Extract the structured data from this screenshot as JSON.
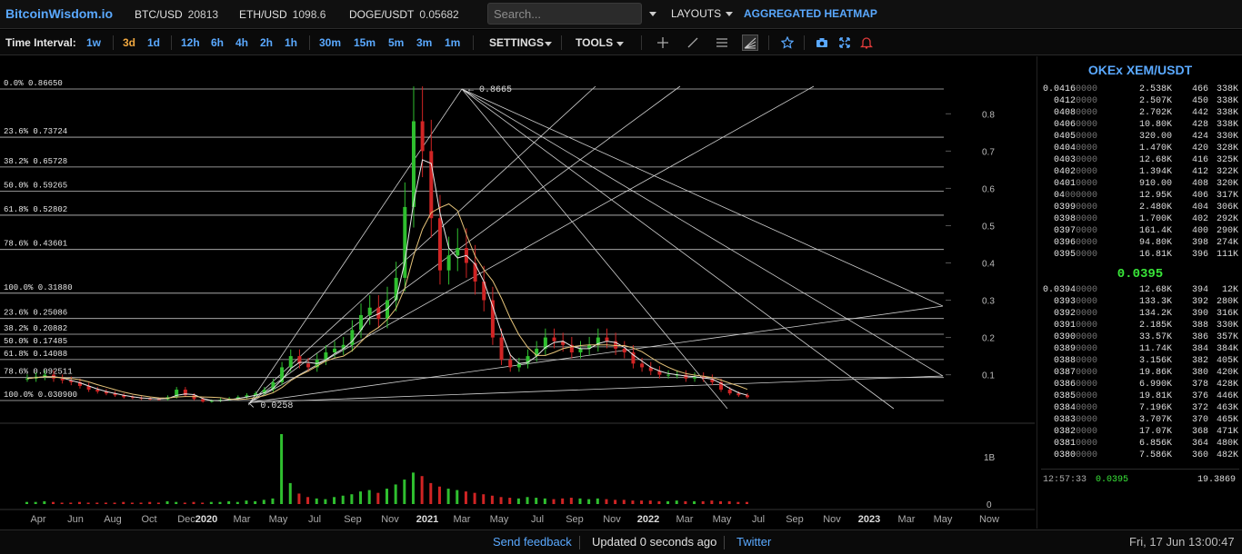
{
  "header": {
    "brand": "BitcoinWisdom.io",
    "tickers": [
      {
        "name": "BTC/USD",
        "value": "20813"
      },
      {
        "name": "ETH/USD",
        "value": "1098.6"
      },
      {
        "name": "DOGE/USDT",
        "value": "0.05682"
      }
    ],
    "search_placeholder": "Search...",
    "layouts_label": "LAYOUTS",
    "heatmap_label": "AGGREGATED HEATMAP"
  },
  "toolbar": {
    "time_interval_label": "Time Interval:",
    "intervals": [
      "1w",
      "3d",
      "1d",
      "12h",
      "6h",
      "4h",
      "2h",
      "1h",
      "30m",
      "15m",
      "5m",
      "3m",
      "1m"
    ],
    "active_interval": "3d",
    "settings_label": "SETTINGS",
    "tools_label": "TOOLS",
    "tool_icons": [
      "crosshair-icon",
      "line-icon",
      "menu-icon",
      "fib-fan-icon",
      "star-icon",
      "camera-icon",
      "fullscreen-icon",
      "bell-icon"
    ]
  },
  "chart_data": {
    "type": "candlestick",
    "pair": "OKEx XEM/USDT",
    "x_ticks": [
      "Apr",
      "Jun",
      "Aug",
      "Oct",
      "Dec",
      "2020",
      "Mar",
      "May",
      "Jul",
      "Sep",
      "Nov",
      "2021",
      "Mar",
      "May",
      "Jul",
      "Sep",
      "Nov",
      "2022",
      "Mar",
      "May",
      "Jul",
      "Sep",
      "Nov",
      "2023",
      "Mar",
      "May",
      "Now"
    ],
    "y_ticks": [
      "0.8",
      "0.7",
      "0.6",
      "0.5",
      "0.4",
      "0.3",
      "0.2",
      "0.1"
    ],
    "volume_ticks": [
      "1B",
      "0"
    ],
    "ylim": [
      0,
      0.9
    ],
    "fib_levels_upper": [
      {
        "label": "0.0% 0.86650",
        "value": 0.8665
      },
      {
        "label": "23.6% 0.73724",
        "value": 0.73724
      },
      {
        "label": "38.2% 0.65728",
        "value": 0.65728
      },
      {
        "label": "50.0% 0.59265",
        "value": 0.59265
      },
      {
        "label": "61.8% 0.52802",
        "value": 0.52802
      },
      {
        "label": "78.6% 0.43601",
        "value": 0.43601
      },
      {
        "label": "100.0% 0.31880",
        "value": 0.3188
      }
    ],
    "fib_levels_lower": [
      {
        "label": "23.6% 0.25086",
        "value": 0.25086
      },
      {
        "label": "38.2% 0.20882",
        "value": 0.20882
      },
      {
        "label": "50.0% 0.17485",
        "value": 0.17485
      },
      {
        "label": "61.8% 0.14088",
        "value": 0.14088
      },
      {
        "label": "78.6% 0.092511",
        "value": 0.092511
      },
      {
        "label": "100.0% 0.030900",
        "value": 0.0309
      }
    ],
    "annotations": [
      {
        "text": "0.8665",
        "value": 0.8665
      },
      {
        "text": "0.0258",
        "value": 0.0258
      }
    ],
    "price_series": [
      0.09,
      0.095,
      0.1,
      0.09,
      0.085,
      0.08,
      0.07,
      0.06,
      0.055,
      0.05,
      0.045,
      0.04,
      0.038,
      0.036,
      0.035,
      0.034,
      0.04,
      0.06,
      0.045,
      0.035,
      0.028,
      0.03,
      0.033,
      0.036,
      0.04,
      0.045,
      0.05,
      0.06,
      0.08,
      0.12,
      0.15,
      0.13,
      0.12,
      0.14,
      0.16,
      0.17,
      0.18,
      0.22,
      0.26,
      0.28,
      0.25,
      0.3,
      0.36,
      0.55,
      0.78,
      0.7,
      0.52,
      0.38,
      0.42,
      0.44,
      0.4,
      0.35,
      0.3,
      0.2,
      0.14,
      0.12,
      0.13,
      0.15,
      0.17,
      0.2,
      0.19,
      0.18,
      0.16,
      0.17,
      0.18,
      0.2,
      0.19,
      0.17,
      0.16,
      0.13,
      0.12,
      0.11,
      0.1,
      0.1,
      0.1,
      0.09,
      0.095,
      0.09,
      0.08,
      0.06,
      0.05,
      0.045,
      0.04
    ],
    "volume_series": [
      0.03,
      0.03,
      0.04,
      0.03,
      0.02,
      0.02,
      0.03,
      0.02,
      0.02,
      0.02,
      0.02,
      0.03,
      0.02,
      0.02,
      0.03,
      0.02,
      0.04,
      0.03,
      0.02,
      0.03,
      0.02,
      0.03,
      0.03,
      0.04,
      0.03,
      0.05,
      0.04,
      0.06,
      0.08,
      1.0,
      0.3,
      0.15,
      0.1,
      0.08,
      0.07,
      0.1,
      0.12,
      0.14,
      0.18,
      0.2,
      0.16,
      0.22,
      0.28,
      0.35,
      0.45,
      0.4,
      0.3,
      0.25,
      0.22,
      0.2,
      0.18,
      0.16,
      0.14,
      0.12,
      0.1,
      0.09,
      0.08,
      0.1,
      0.09,
      0.08,
      0.07,
      0.08,
      0.09,
      0.08,
      0.07,
      0.08,
      0.07,
      0.06,
      0.06,
      0.05,
      0.05,
      0.05,
      0.04,
      0.04,
      0.05,
      0.04,
      0.04,
      0.04,
      0.05,
      0.04,
      0.04,
      0.03,
      0.03
    ]
  },
  "orderbook": {
    "title": "OKEx XEM/USDT",
    "asks": [
      {
        "p": "0.0416",
        "z": "0000",
        "v": "2.538K",
        "c": "466",
        "s": "338K"
      },
      {
        "p": "0412",
        "z": "0000",
        "v": "2.507K",
        "c": "450",
        "s": "338K"
      },
      {
        "p": "0408",
        "z": "0000",
        "v": "2.702K",
        "c": "442",
        "s": "338K"
      },
      {
        "p": "0406",
        "z": "0000",
        "v": "10.80K",
        "c": "428",
        "s": "338K"
      },
      {
        "p": "0405",
        "z": "0000",
        "v": "320.00",
        "c": "424",
        "s": "330K"
      },
      {
        "p": "0404",
        "z": "0000",
        "v": "1.470K",
        "c": "420",
        "s": "328K"
      },
      {
        "p": "0403",
        "z": "0000",
        "v": "12.68K",
        "c": "416",
        "s": "325K"
      },
      {
        "p": "0402",
        "z": "0000",
        "v": "1.394K",
        "c": "412",
        "s": "322K"
      },
      {
        "p": "0401",
        "z": "0000",
        "v": "910.00",
        "c": "408",
        "s": "320K"
      },
      {
        "p": "04",
        "z": "000000",
        "v": "12.95K",
        "c": "406",
        "s": "317K"
      },
      {
        "p": "0399",
        "z": "0000",
        "v": "2.480K",
        "c": "404",
        "s": "306K"
      },
      {
        "p": "0398",
        "z": "0000",
        "v": "1.700K",
        "c": "402",
        "s": "292K"
      },
      {
        "p": "0397",
        "z": "0000",
        "v": "161.4K",
        "c": "400",
        "s": "290K"
      },
      {
        "p": "0396",
        "z": "0000",
        "v": "94.80K",
        "c": "398",
        "s": "274K"
      },
      {
        "p": "0395",
        "z": "0000",
        "v": "16.81K",
        "c": "396",
        "s": "111K"
      }
    ],
    "mid": "0.0395",
    "bids": [
      {
        "p": "0.0394",
        "z": "0000",
        "v": "12.68K",
        "c": "394",
        "s": "12K"
      },
      {
        "p": "0393",
        "z": "0000",
        "v": "133.3K",
        "c": "392",
        "s": "280K"
      },
      {
        "p": "0392",
        "z": "0000",
        "v": "134.2K",
        "c": "390",
        "s": "316K"
      },
      {
        "p": "0391",
        "z": "0000",
        "v": "2.185K",
        "c": "388",
        "s": "330K"
      },
      {
        "p": "0390",
        "z": "0000",
        "v": "33.57K",
        "c": "386",
        "s": "357K"
      },
      {
        "p": "0389",
        "z": "0000",
        "v": "11.74K",
        "c": "384",
        "s": "384K"
      },
      {
        "p": "0388",
        "z": "0000",
        "v": "3.156K",
        "c": "382",
        "s": "405K"
      },
      {
        "p": "0387",
        "z": "0000",
        "v": "19.86K",
        "c": "380",
        "s": "420K"
      },
      {
        "p": "0386",
        "z": "0000",
        "v": "6.990K",
        "c": "378",
        "s": "428K"
      },
      {
        "p": "0385",
        "z": "0000",
        "v": "19.81K",
        "c": "376",
        "s": "446K"
      },
      {
        "p": "0384",
        "z": "0000",
        "v": "7.196K",
        "c": "372",
        "s": "463K"
      },
      {
        "p": "0383",
        "z": "0000",
        "v": "3.707K",
        "c": "370",
        "s": "465K"
      },
      {
        "p": "0382",
        "z": "0000",
        "v": "17.07K",
        "c": "368",
        "s": "471K"
      },
      {
        "p": "0381",
        "z": "0000",
        "v": "6.856K",
        "c": "364",
        "s": "480K"
      },
      {
        "p": "0380",
        "z": "0000",
        "v": "7.586K",
        "c": "360",
        "s": "482K"
      }
    ],
    "last_time": "12:57:33",
    "last_price": "0.0395",
    "last_size": "19.3869"
  },
  "status": {
    "feedback": "Send feedback",
    "updated": "Updated 0 seconds ago",
    "twitter": "Twitter",
    "datetime": "Fri, 17 Jun 13:00:47"
  },
  "colors": {
    "accent": "#5aa9ff",
    "active_interval": "#f0a840",
    "bull": "#2fbf2f",
    "bear": "#d02424",
    "mid_price": "#39e639"
  }
}
